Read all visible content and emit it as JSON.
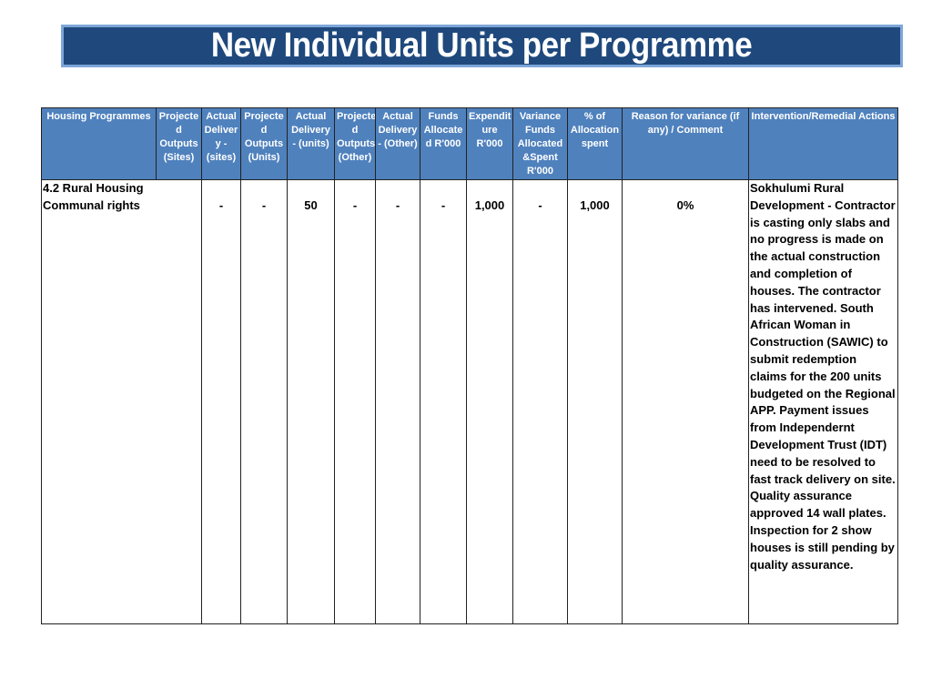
{
  "title": "New Individual Units per Programme",
  "table": {
    "headers": [
      "Housing Programmes",
      "Projecte d Outputs (Sites)",
      "Actual Deliver y - (sites)",
      "Projecte d Outputs (Units)",
      "Actual Delivery - (units)",
      "Projecte d Outputs (Other)",
      "Actual Delivery - (Other)",
      "Funds Allocate d R'000",
      "Expendit ure R'000",
      "Variance Funds Allocated &Spent R'000",
      "% of Allocation spent",
      "Reason for variance (if any) / Comment",
      "Intervention/Remedial Actions"
    ],
    "rows": [
      {
        "programme": "4.2 Rural Housing Communal rights",
        "actual_delivery_sites": "-",
        "projected_outputs_units": "-",
        "actual_delivery_units": "50",
        "projected_outputs_other": "-",
        "actual_delivery_other": "-",
        "funds_allocated": "-",
        "expenditure": "1,000",
        "variance": "-",
        "pct_allocation_spent": "1,000",
        "reason_for_variance": "0%",
        "intervention": "Sokhulumi Rural Development - Contractor is casting only slabs and no progress is made on the actual construction and completion of houses. The contractor has intervened. South African Woman in Construction (SAWIC) to submit redemption claims for the 200 units budgeted on the Regional APP. Payment issues from Independernt Development Trust (IDT) need to be resolved to fast track delivery on site. Quality assurance approved 14 wall plates. Inspection for 2 show houses is still pending by quality assurance."
      }
    ]
  },
  "colors": {
    "title_bg": "#1f497d",
    "title_border": "#7ea6d8",
    "header_bg": "#4f81bd"
  }
}
